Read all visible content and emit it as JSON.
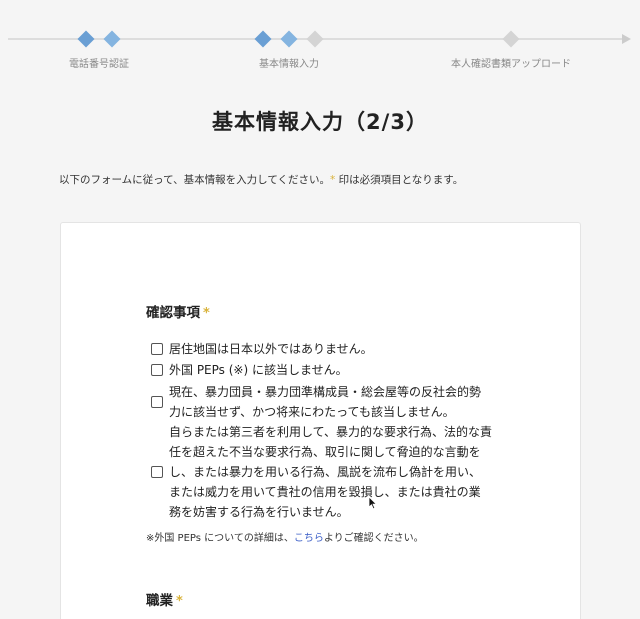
{
  "steps": [
    {
      "label": "電話番号認証",
      "state": "done"
    },
    {
      "label": "基本情報入力",
      "state": "current"
    },
    {
      "label": "本人確認書類アップロード",
      "state": "todo"
    }
  ],
  "page_title": "基本情報入力（2/3）",
  "intro": {
    "before": "以下のフォームに従って、基本情報を入力してください。",
    "mark": "*",
    "after": " 印は必須項目となります。"
  },
  "confirm_section": {
    "title": "確認事項",
    "required_mark": "*",
    "items": [
      {
        "lines": [
          "居住地国は日本以外ではありません。"
        ],
        "checked": false
      },
      {
        "lines": [
          "外国 PEPs (※) に該当しません。"
        ],
        "checked": false
      },
      {
        "lines": [
          "現在、暴力団員・暴力団準構成員・総会屋等の反社会的勢",
          "力に該当せず、かつ将来にわたっても該当しません。"
        ],
        "checked": false
      },
      {
        "lines": [
          "自らまたは第三者を利用して、暴力的な要求行為、法的な責",
          "任を超えた不当な要求行為、取引に関して脅迫的な言動を",
          "し、または暴力を用いる行為、風説を流布し偽計を用い、",
          "または威力を用いて貴社の信用を毀損し、または貴社の業",
          "務を妨害する行為を行いません。"
        ],
        "checked": false
      }
    ]
  },
  "note": {
    "before": "※外国 PEPs についての詳細は、",
    "link": "こちら",
    "after": "よりご確認ください。"
  },
  "occupation_section": {
    "title": "職業",
    "required_mark": "*"
  },
  "colors": {
    "accent_blue": "#6a9fd4",
    "required_mark": "#d9b23a",
    "link": "#3b5ec7"
  }
}
